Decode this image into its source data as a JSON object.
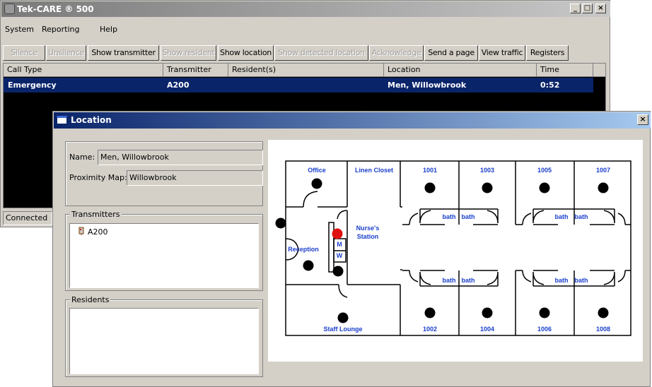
{
  "main_window": {
    "title": "Tek-CARE ® 500",
    "controls": {
      "minimize": "_",
      "maximize": "□",
      "close": "×"
    },
    "menu": [
      "System",
      "Reporting",
      "Help"
    ],
    "toolbar": [
      {
        "label": "Silence",
        "enabled": false
      },
      {
        "label": "Unsilence",
        "enabled": false
      },
      {
        "label": "Show transmitter",
        "enabled": true
      },
      {
        "label": "Show resident",
        "enabled": false
      },
      {
        "label": "Show location",
        "enabled": true
      },
      {
        "label": "Show detected location",
        "enabled": false
      },
      {
        "label": "Acknowledge",
        "enabled": false
      },
      {
        "label": "Send a page",
        "enabled": true
      },
      {
        "label": "View traffic",
        "enabled": true
      },
      {
        "label": "Registers",
        "enabled": true
      }
    ],
    "columns": [
      "Call Type",
      "Transmitter",
      "Resident(s)",
      "Location",
      "Time"
    ],
    "rows": [
      {
        "call_type": "Emergency",
        "transmitter": "A200",
        "residents": "",
        "location": "Men, Willowbrook",
        "time": "0:52"
      }
    ],
    "status": "Connected"
  },
  "location_dialog": {
    "title": "Location",
    "close": "×",
    "name_label": "Name:",
    "name_value": "Men, Willowbrook",
    "map_label": "Proximity Map:",
    "map_value": "Willowbrook",
    "transmitters_label": "Transmitters",
    "transmitters": [
      "A200"
    ],
    "residents_label": "Residents",
    "residents": []
  },
  "floor_map": {
    "rooms": {
      "office": "Office",
      "linen": "Linen Closet",
      "nurse1": "Nurse's",
      "nurse2": "Station",
      "reception": "Reception",
      "staff": "Staff Lounge",
      "r1001": "1001",
      "r1003": "1003",
      "r1005": "1005",
      "r1007": "1007",
      "r1002": "1002",
      "r1004": "1004",
      "r1006": "1006",
      "r1008": "1008",
      "men": "M",
      "women": "W",
      "bath": "bath"
    },
    "colors": {
      "label": "#1a3fcc",
      "active_marker": "#e01010",
      "marker": "#000000"
    }
  }
}
